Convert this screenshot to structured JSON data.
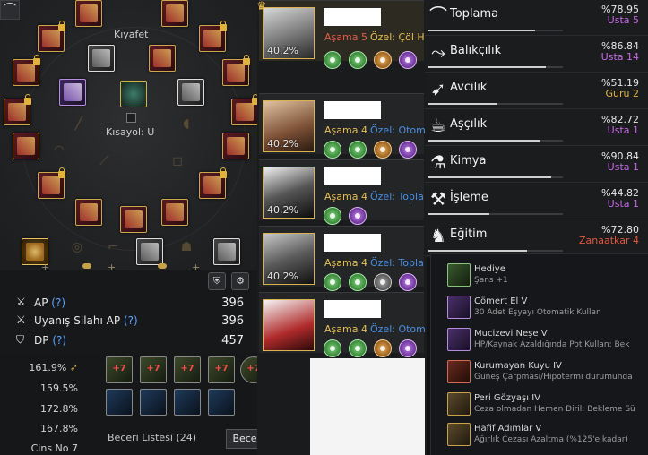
{
  "equipment": {
    "costume_label": "Kıyafet",
    "shortcut_label": "Kısayol: U",
    "stats": [
      {
        "icon": "sword-icon",
        "label": "AP",
        "help": "(?)",
        "value": "396"
      },
      {
        "icon": "awakening-sword-icon",
        "label": "Uyanış Silahı AP",
        "help": "(?)",
        "value": "396"
      },
      {
        "icon": "shield-icon",
        "label": "DP",
        "help": "(?)",
        "value": "457"
      }
    ]
  },
  "horse": {
    "stats": [
      "161.9%",
      "159.5%",
      "172.8%",
      "167.8%",
      "Cins No 7"
    ],
    "skill_labels": [
      "+7",
      "+7",
      "+7",
      "+7",
      "+7"
    ],
    "skill_list_label": "Beceri Listesi (24)",
    "change_skill_button": "Beceri Değiştir"
  },
  "pets": [
    {
      "stage": "Aşama 5",
      "special": "Özel: Çöl H",
      "percent": "40.2%",
      "stage_color": "red",
      "special_color": "blue"
    },
    {
      "stage": "Aşama 4",
      "special": "Özel: Otom",
      "percent": "40.2%",
      "stage_color": "gold",
      "special_color": "blue"
    },
    {
      "stage": "Aşama 4",
      "special": "Özel: Topla",
      "percent": "40.2%",
      "stage_color": "gold",
      "special_color": "blue"
    },
    {
      "stage": "Aşama 4",
      "special": "Özel: Topla",
      "percent": "40.2%",
      "stage_color": "gold",
      "special_color": "blue"
    },
    {
      "stage": "Aşama 4",
      "special": "Özel: Otom",
      "percent": "",
      "stage_color": "gold",
      "special_color": "blue"
    }
  ],
  "life_skills": [
    {
      "icon": "sickle-icon",
      "name": "Toplama",
      "percent": "%78.95",
      "rank": "Usta 5",
      "rank_type": "usta",
      "progress": 0.79
    },
    {
      "icon": "fish-icon",
      "name": "Balıkçılık",
      "percent": "%86.84",
      "rank": "Usta 14",
      "rank_type": "usta",
      "progress": 0.87
    },
    {
      "icon": "rifle-icon",
      "name": "Avcılık",
      "percent": "%51.19",
      "rank": "Guru 2",
      "rank_type": "guru",
      "progress": 0.51
    },
    {
      "icon": "chicken-icon",
      "name": "Aşçılık",
      "percent": "%82.72",
      "rank": "Usta 1",
      "rank_type": "usta",
      "progress": 0.83
    },
    {
      "icon": "flask-icon",
      "name": "Kimya",
      "percent": "%90.84",
      "rank": "Usta 1",
      "rank_type": "usta",
      "progress": 0.91
    },
    {
      "icon": "hammer-icon",
      "name": "İşleme",
      "percent": "%44.82",
      "rank": "Usta 1",
      "rank_type": "usta",
      "progress": 0.45
    },
    {
      "icon": "horse-icon",
      "name": "Eğitim",
      "percent": "%72.80",
      "rank": "Zanaatkar 4",
      "rank_type": "zan",
      "progress": 0.73
    }
  ],
  "buffs": [
    {
      "icon": "clover-icon",
      "color": "green",
      "name": "Hediye",
      "desc": "Şans +1"
    },
    {
      "icon": "flower-icon",
      "color": "purple",
      "name": "Cömert El V",
      "desc": "30 Adet Eşyayı Otomatik Kullan"
    },
    {
      "icon": "potion-icon",
      "color": "purple",
      "name": "Mucizevi Neşe V",
      "desc": "HP/Kaynak Azaldığında Pot Kullan: Bek"
    },
    {
      "icon": "pillar-icon",
      "color": "red",
      "name": "Kurumayan Kuyu IV",
      "desc": "Güneş Çarpması/Hipotermi durumunda"
    },
    {
      "icon": "tear-icon",
      "color": "gold",
      "name": "Peri Gözyaşı IV",
      "desc": "Ceza olmadan Hemen Diril: Bekleme Sü"
    },
    {
      "icon": "feather-icon",
      "color": "gold",
      "name": "Hafif Adımlar V",
      "desc": "Ağırlık Cezası Azaltma (%125'e kadar)"
    }
  ]
}
